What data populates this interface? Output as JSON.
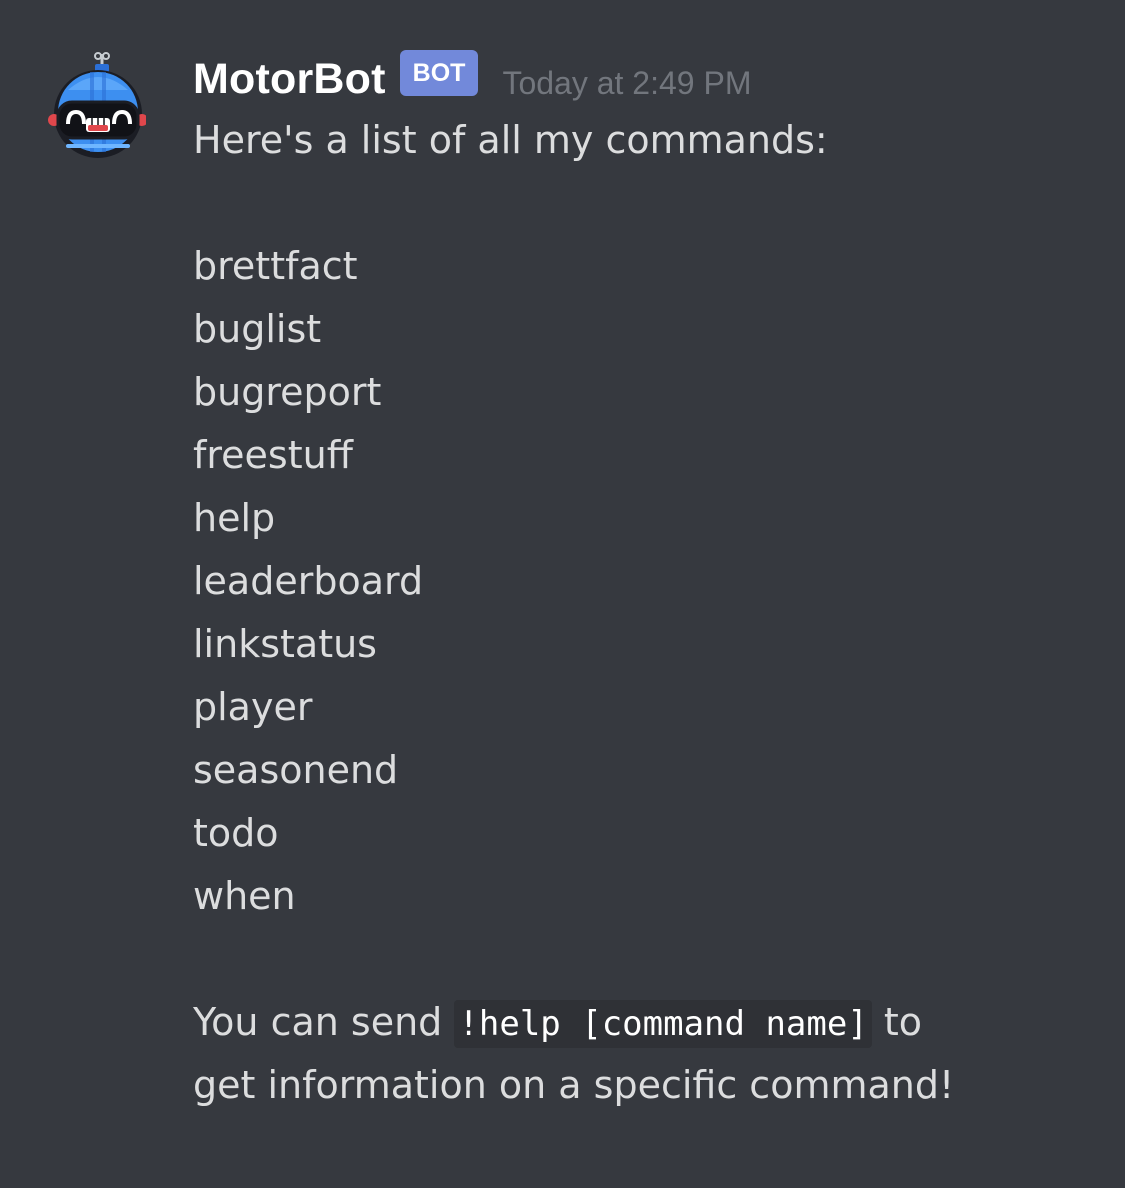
{
  "message": {
    "author": "MotorBot",
    "bot_tag": "BOT",
    "timestamp": "Today at 2:49 PM",
    "intro": "Here's a list of all my commands:",
    "commands": [
      "brettfact",
      "buglist",
      "bugreport",
      "freestuff",
      "help",
      "leaderboard",
      "linkstatus",
      "player",
      "seasonend",
      "todo",
      "when"
    ],
    "footer_prefix": "You can send",
    "footer_code": "!help [command name]",
    "footer_suffix": "to",
    "footer_line2": "get information on a specific command!"
  },
  "colors": {
    "background": "#36393f",
    "bot_tag": "#7289da",
    "text": "#dcddde",
    "timestamp": "#72767d",
    "code_bg": "#2f3136"
  },
  "icons": {
    "avatar": "robot-avatar-icon"
  }
}
